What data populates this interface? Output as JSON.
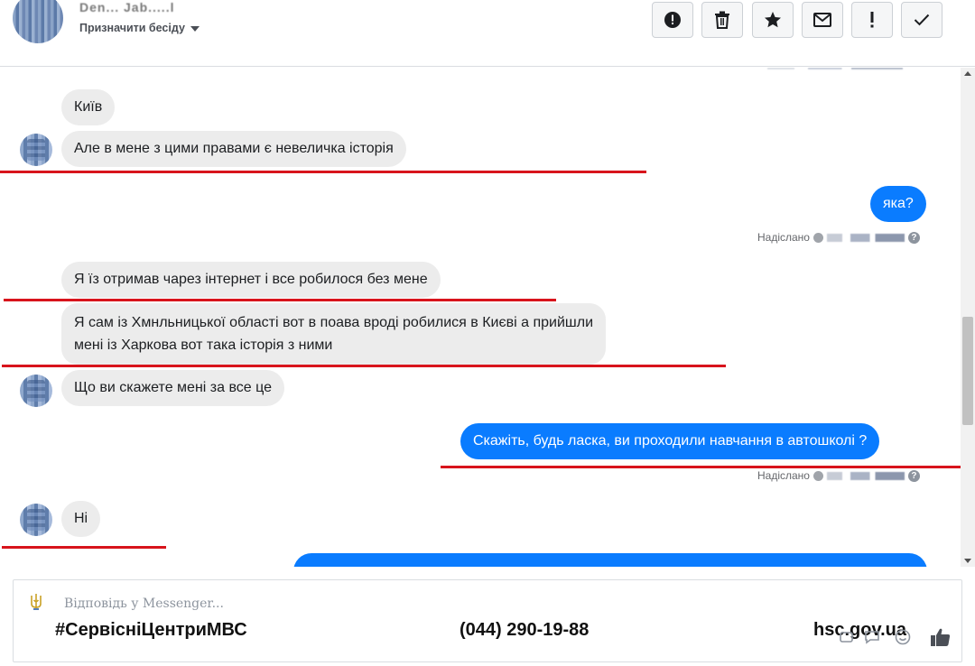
{
  "header": {
    "contact_name": "Den... Jab.....l",
    "assign_label": "Призначити бесіду",
    "tools": [
      {
        "icon": "alert-circle-icon",
        "name": "mark-spam-button"
      },
      {
        "icon": "trash-icon",
        "name": "delete-button"
      },
      {
        "icon": "star-icon",
        "name": "star-button"
      },
      {
        "icon": "envelope-icon",
        "name": "mark-unread-button"
      },
      {
        "icon": "exclamation-icon",
        "name": "flag-button"
      },
      {
        "icon": "check-icon",
        "name": "mark-done-button"
      }
    ]
  },
  "messages": [
    {
      "side": "in",
      "text": "Київ"
    },
    {
      "side": "in",
      "text": "Але в мене з цими правами є невеличка історія"
    },
    {
      "side": "out",
      "text": "яка?"
    },
    {
      "side": "in",
      "text": "Я їз отримав чарез інтернет і все робилося без мене"
    },
    {
      "side": "in",
      "text": "Я сам із Хмнльницької області вот в поава вроді робилися в Києві а прийшли"
    },
    {
      "side": "in",
      "text": "мені із Харкова вот така історія з ними"
    },
    {
      "side": "in",
      "text": "Що ви скажете мені за все це"
    },
    {
      "side": "out",
      "text": "Скажіть, будь ласка, ви проходили навчання в автошколі ?"
    },
    {
      "side": "in",
      "text": "Ні"
    }
  ],
  "status": {
    "sent_label": "Надіслано",
    "help_glyph": "?"
  },
  "footer": {
    "reply_placeholder": "Відповідь у Messenger...",
    "hashtag": "#СервісніЦентриМВС",
    "phone": "(044) 290-19-88",
    "website": "hsc.gov.ua"
  },
  "colors": {
    "outgoing_bubble": "#0a7cff",
    "incoming_bubble": "#ececec",
    "annotation_line": "#d8141c"
  }
}
